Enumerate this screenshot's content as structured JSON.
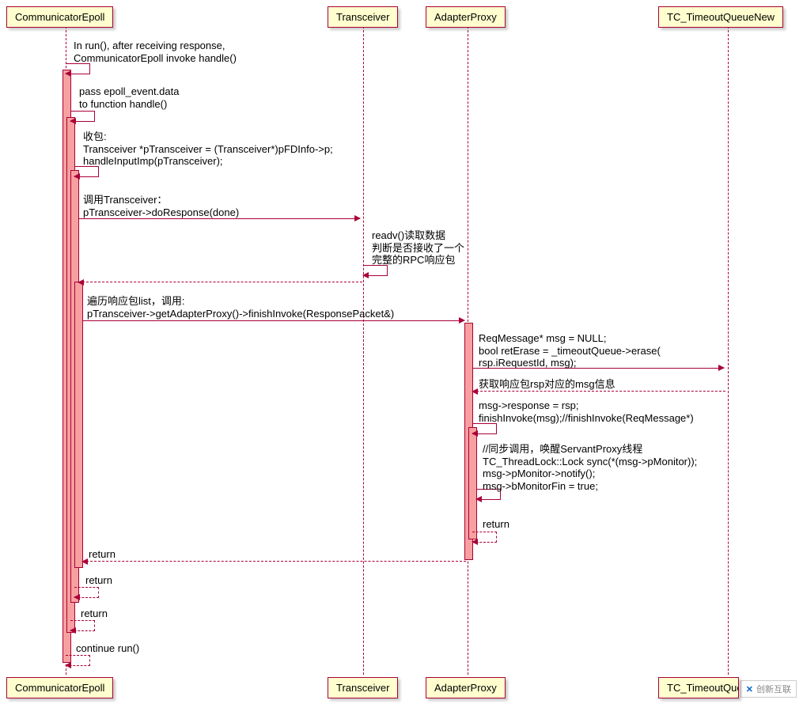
{
  "participants": {
    "p1": "CommunicatorEpoll",
    "p2": "Transceiver",
    "p3": "AdapterProxy",
    "p4": "TC_TimeoutQueueNew"
  },
  "messages": {
    "m1": "In run(), after receiving response,\nCommunicatorEpoll invoke handle()",
    "m2": "pass epoll_event.data\nto function handle()",
    "m3": "收包:\nTransceiver *pTransceiver = (Transceiver*)pFDInfo->p;\nhandleInputImp(pTransceiver);",
    "m4": "调用Transceiver：\npTransceiver->doResponse(done)",
    "m5": "readv()读取数据\n判断是否接收了一个\n完整的RPC响应包",
    "m6": "遍历响应包list，调用:\npTransceiver->getAdapterProxy()->finishInvoke(ResponsePacket&)",
    "m7": "ReqMessage* msg = NULL;\nbool retErase = _timeoutQueue->erase(\nrsp.iRequestId, msg);",
    "m8": "获取响应包rsp对应的msg信息",
    "m9": "msg->response = rsp;\nfinishInvoke(msg);//finishInvoke(ReqMessage*)",
    "m10": "//同步调用，唤醒ServantProxy线程\nTC_ThreadLock::Lock sync(*(msg->pMonitor));\nmsg->pMonitor->notify();\nmsg->bMonitorFin = true;",
    "m11": "return",
    "m12": "return",
    "m13": "return",
    "m14": "return",
    "m15": "continue run()"
  },
  "watermark": "创新互联"
}
